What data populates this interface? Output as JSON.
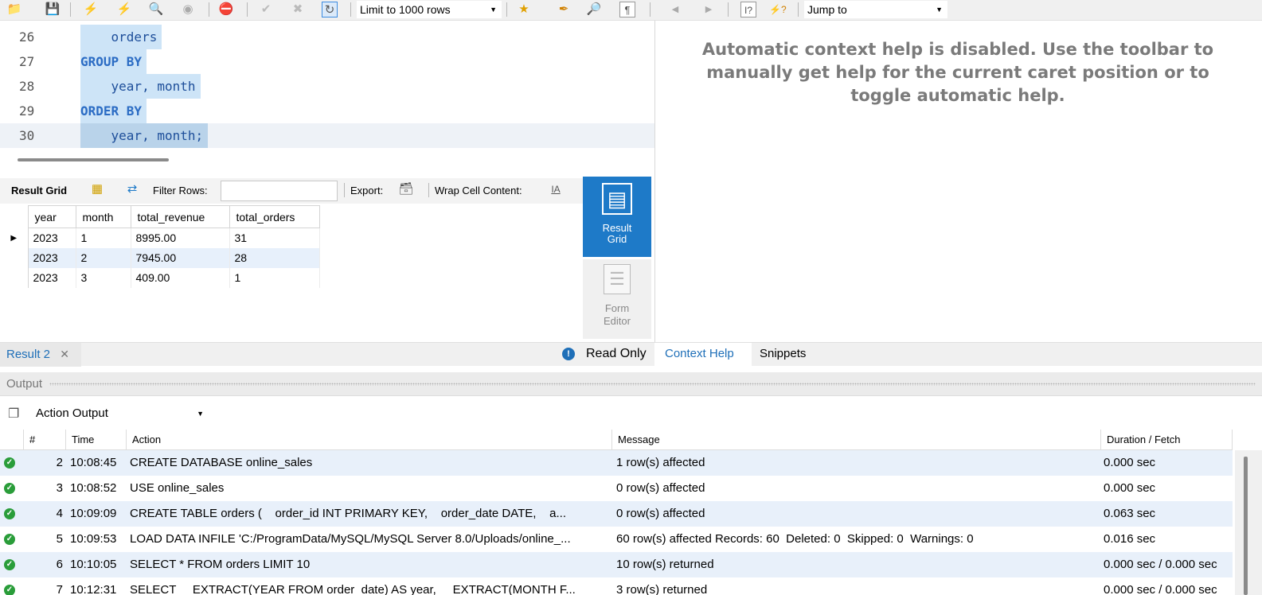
{
  "toolbar": {
    "limit_label": "Limit to 1000 rows",
    "jump_to_label": "Jump to",
    "icons": [
      "folder-icon",
      "save-icon",
      "execute-icon",
      "execute-current-icon",
      "explain-icon",
      "stop-icon",
      "toggle-error-icon",
      "commit-icon",
      "rollback-icon",
      "autocommit-icon",
      "add-snippet-icon",
      "beautify-icon",
      "find-icon",
      "invisible-chars-icon",
      "back-icon",
      "forward-icon",
      "context-help-icon",
      "auto-help-icon"
    ]
  },
  "editor": {
    "lines": [
      {
        "num": "26",
        "code": "    orders",
        "kw": ""
      },
      {
        "num": "27",
        "code": "GROUP BY",
        "kw": "kw"
      },
      {
        "num": "28",
        "code": "    year, month",
        "kw": ""
      },
      {
        "num": "29",
        "code": "ORDER BY",
        "kw": "kw"
      },
      {
        "num": "30",
        "code": "    year, month;",
        "kw": ""
      }
    ]
  },
  "result_toolbar": {
    "result_grid_label": "Result Grid",
    "filter_rows_label": "Filter Rows:",
    "export_label": "Export:",
    "wrap_label": "Wrap Cell Content:"
  },
  "result_grid": {
    "columns": [
      "year",
      "month",
      "total_revenue",
      "total_orders"
    ],
    "rows": [
      [
        "2023",
        "1",
        "8995.00",
        "31"
      ],
      [
        "2023",
        "2",
        "7945.00",
        "28"
      ],
      [
        "2023",
        "3",
        "409.00",
        "1"
      ]
    ]
  },
  "side_panel": {
    "result_grid_label_1": "Result",
    "result_grid_label_2": "Grid",
    "form_editor_label_1": "Form",
    "form_editor_label_2": "Editor"
  },
  "result_tabs": {
    "tab_label": "Result 2",
    "read_only_label": "Read Only"
  },
  "context_help": {
    "message": "Automatic context help is disabled. Use the toolbar to manually get help for the current caret position or to toggle automatic help.",
    "tab_context_help": "Context Help",
    "tab_snippets": "Snippets"
  },
  "output": {
    "header": "Output",
    "selector": "Action Output",
    "columns": [
      "#",
      "Time",
      "Action",
      "Message",
      "Duration / Fetch"
    ],
    "rows": [
      {
        "num": "2",
        "time": "10:08:45",
        "action": "CREATE DATABASE online_sales",
        "message": "1 row(s) affected",
        "duration": "0.000 sec"
      },
      {
        "num": "3",
        "time": "10:08:52",
        "action": "USE online_sales",
        "message": "0 row(s) affected",
        "duration": "0.000 sec"
      },
      {
        "num": "4",
        "time": "10:09:09",
        "action": "CREATE TABLE orders (    order_id INT PRIMARY KEY,    order_date DATE,    a...",
        "message": "0 row(s) affected",
        "duration": "0.063 sec"
      },
      {
        "num": "5",
        "time": "10:09:53",
        "action": "LOAD DATA INFILE 'C:/ProgramData/MySQL/MySQL Server 8.0/Uploads/online_...",
        "message": "60 row(s) affected Records: 60  Deleted: 0  Skipped: 0  Warnings: 0",
        "duration": "0.016 sec"
      },
      {
        "num": "6",
        "time": "10:10:05",
        "action": "SELECT * FROM orders LIMIT 10",
        "message": "10 row(s) returned",
        "duration": "0.000 sec / 0.000 sec"
      },
      {
        "num": "7",
        "time": "10:12:31",
        "action": "SELECT     EXTRACT(YEAR FROM order_date) AS year,     EXTRACT(MONTH F...",
        "message": "3 row(s) returned",
        "duration": "0.000 sec / 0.000 sec"
      }
    ]
  },
  "colors": {
    "accent": "#1e7ac8",
    "selection": "#cde4f7",
    "ok": "#2a9d3a"
  }
}
